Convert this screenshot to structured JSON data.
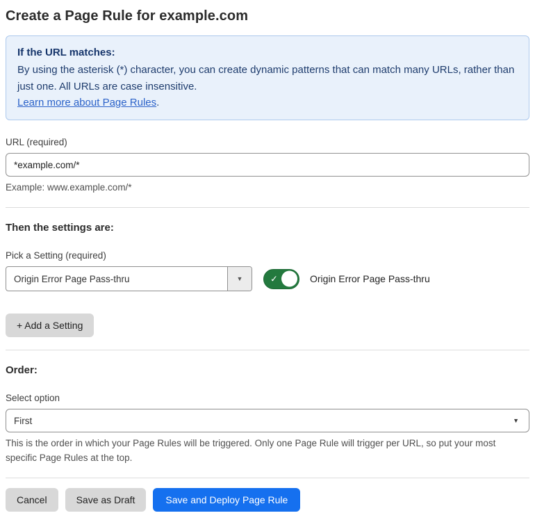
{
  "page": {
    "title": "Create a Page Rule for example.com"
  },
  "info_box": {
    "heading": "If the URL matches:",
    "body": "By using the asterisk (*) character, you can create dynamic patterns that can match many URLs, rather than just one. All URLs are case insensitive.",
    "link": "Learn more about Page Rules",
    "link_suffix": "."
  },
  "url_field": {
    "label": "URL (required)",
    "value": "*example.com/*",
    "helper": "Example: www.example.com/*"
  },
  "settings": {
    "heading": "Then the settings are:",
    "picker_label": "Pick a Setting (required)",
    "picker_value": "Origin Error Page Pass-thru",
    "toggle_state": "on",
    "toggle_check": "✓",
    "toggle_label": "Origin Error Page Pass-thru",
    "add_button_label": "+ Add a Setting"
  },
  "order": {
    "heading": "Order:",
    "select_label": "Select option",
    "select_value": "First",
    "helper": "This is the order in which your Page Rules will be triggered. Only one Page Rule will trigger per URL, so put your most specific Page Rules at the top."
  },
  "footer": {
    "cancel_label": "Cancel",
    "save_draft_label": "Save as Draft",
    "save_deploy_label": "Save and Deploy Page Rule"
  },
  "icons": {
    "dropdown_arrow": "▼"
  },
  "colors": {
    "primary_blue": "#1570ef",
    "toggle_green": "#23793e",
    "info_box_bg": "#e9f1fb",
    "info_box_border": "#adc9ed",
    "info_text_navy": "#1e3c6d",
    "link_blue": "#2b62c9",
    "gray_button_bg": "#d8d8d8"
  }
}
